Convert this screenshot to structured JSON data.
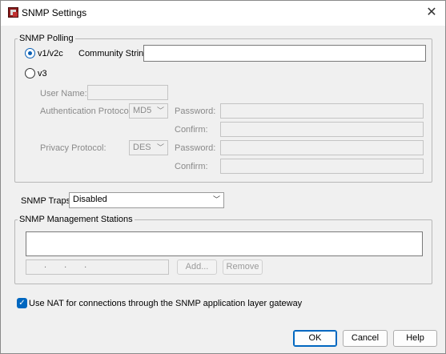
{
  "window": {
    "title": "SNMP Settings",
    "close_glyph": "✕"
  },
  "polling": {
    "group_title": "SNMP Polling",
    "v1v2c_label": "v1/v2c",
    "v1v2c_selected": true,
    "community_label": "Community String:",
    "community_value": "",
    "v3_label": "v3",
    "v3_selected": false,
    "username_label": "User Name:",
    "username_value": "",
    "auth_protocol_label": "Authentication Protocol:",
    "auth_protocol_value": "MD5",
    "auth_password_label": "Password:",
    "auth_confirm_label": "Confirm:",
    "privacy_protocol_label": "Privacy Protocol:",
    "privacy_protocol_value": "DES",
    "privacy_password_label": "Password:",
    "privacy_confirm_label": "Confirm:"
  },
  "traps": {
    "label": "SNMP Traps:",
    "value": "Disabled"
  },
  "stations": {
    "group_title": "SNMP Management Stations",
    "ip_dots": [
      ".",
      ".",
      "."
    ],
    "add_label": "Add...",
    "remove_label": "Remove"
  },
  "nat": {
    "label": "Use NAT for connections through the SNMP application layer gateway",
    "checked": true
  },
  "buttons": {
    "ok": "OK",
    "cancel": "Cancel",
    "help": "Help"
  },
  "icons": {
    "app": "snmp-app-icon",
    "close": "close-icon",
    "chevron": "chevron-down-icon",
    "check": "checkmark-icon"
  },
  "colors": {
    "accent": "#0067c0",
    "window_bg": "#f0f0f0",
    "disabled_text": "#8a8a8a"
  }
}
